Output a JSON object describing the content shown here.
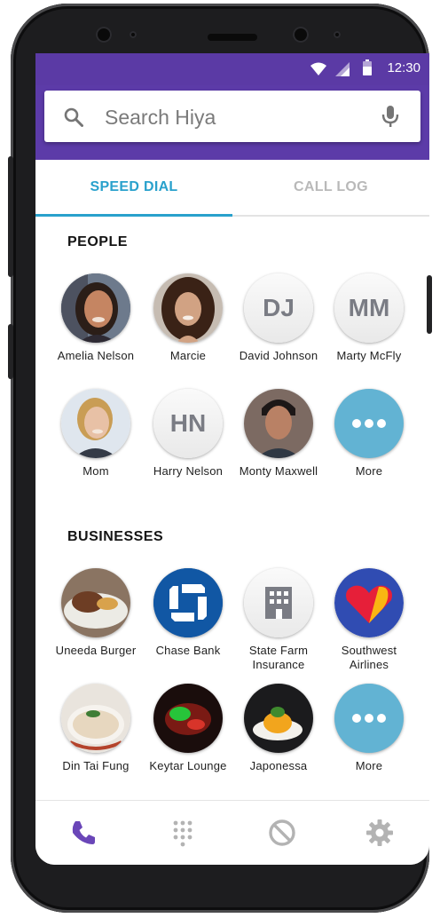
{
  "status": {
    "time": "12:30"
  },
  "search": {
    "placeholder": "Search Hiya"
  },
  "tabs": [
    {
      "label": "SPEED DIAL",
      "active": true
    },
    {
      "label": "CALL LOG",
      "active": false
    }
  ],
  "people": {
    "title": "PEOPLE",
    "items": [
      {
        "label": "Amelia Nelson"
      },
      {
        "label": "Marcie"
      },
      {
        "label": "David Johnson",
        "initials": "DJ"
      },
      {
        "label": "Marty McFly",
        "initials": "MM"
      },
      {
        "label": "Mom"
      },
      {
        "label": "Harry Nelson",
        "initials": "HN"
      },
      {
        "label": "Monty Maxwell"
      },
      {
        "label": "More"
      }
    ]
  },
  "businesses": {
    "title": "BUSINESSES",
    "items": [
      {
        "label": "Uneeda Burger"
      },
      {
        "label": "Chase Bank"
      },
      {
        "label": "State Farm Insurance"
      },
      {
        "label": "Southwest Airlines"
      },
      {
        "label": "Din Tai Fung"
      },
      {
        "label": "Keytar Lounge"
      },
      {
        "label": "Japonessa"
      },
      {
        "label": "More"
      }
    ]
  },
  "nav": [
    "phone-icon",
    "dialpad-icon",
    "block-icon",
    "settings-icon"
  ],
  "colors": {
    "accent": "#29a1cc",
    "header": "#5c3ba8",
    "more": "#62b3d3",
    "nav_active": "#6a46b8"
  }
}
